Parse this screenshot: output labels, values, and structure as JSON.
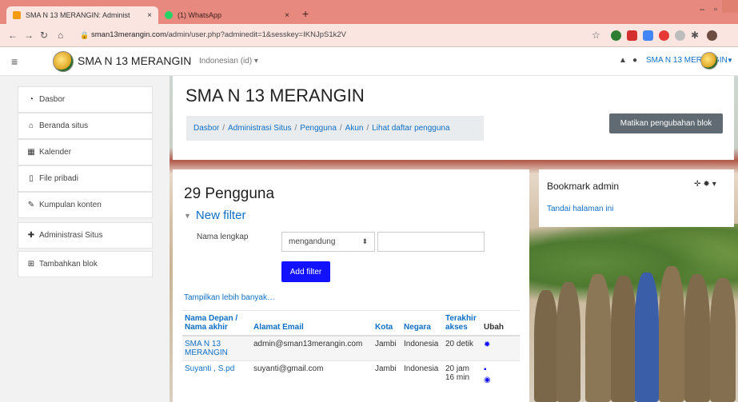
{
  "browser": {
    "tabs": [
      {
        "title": "SMA N 13 MERANGIN: Administ",
        "close": "×",
        "active": true
      },
      {
        "title": "(1) WhatsApp",
        "close": "×",
        "active": false
      }
    ],
    "new_tab": "+",
    "url_host": "sman13merangin.com",
    "url_path": "/admin/user.php?adminedit=1&sesskey=IKNJpS1k2V"
  },
  "navbar": {
    "site_name": "SMA N 13 MERANGIN",
    "language": "Indonesian (id) ▾",
    "user_name": "SMA N 13 MERANGIN"
  },
  "sidebar": {
    "items": [
      {
        "label": "Dasbor",
        "icon": "dashboard-icon"
      },
      {
        "label": "Beranda situs",
        "icon": "home-icon"
      },
      {
        "label": "Kalender",
        "icon": "calendar-icon"
      },
      {
        "label": "File pribadi",
        "icon": "file-icon"
      },
      {
        "label": "Kumpulan konten",
        "icon": "paintbrush-icon"
      },
      {
        "label": "Administrasi Situs",
        "icon": "wrench-icon"
      },
      {
        "label": "Tambahkan blok",
        "icon": "plus-square-icon"
      }
    ]
  },
  "header": {
    "title": "SMA N 13 MERANGIN",
    "breadcrumb": [
      "Dasbor",
      "Administrasi Situs",
      "Pengguna",
      "Akun",
      "Lihat daftar pengguna"
    ],
    "separator": "/",
    "edit_button": "Matikan pengubahan blok"
  },
  "main": {
    "users_title": "29 Pengguna",
    "filter_heading": "New filter",
    "filter_label": "Nama lengkap",
    "filter_operator": "mengandung",
    "filter_value": "",
    "add_filter": "Add filter",
    "show_more": "Tampilkan lebih banyak…",
    "columns": {
      "name_line1": "Nama Depan /",
      "name_line2": "Nama akhir",
      "email": "Alamat Email",
      "city": "Kota",
      "country": "Negara",
      "last_line1": "Terakhir",
      "last_line2": "akses",
      "edit": "Ubah"
    },
    "rows": [
      {
        "name_line1": "SMA N 13",
        "name_line2": "MERANGIN",
        "email": "admin@sman13merangin.com",
        "city": "Jambi",
        "country": "Indonesia",
        "last_line1": "20 detik",
        "last_line2": "",
        "actions": [
          "gear-icon"
        ]
      },
      {
        "name_line1": "Suyanti , S.pd",
        "name_line2": "",
        "email": "suyanti@gmail.com",
        "city": "Jambi",
        "country": "Indonesia",
        "last_line1": "20 jam",
        "last_line2": "16 min",
        "actions": [
          "trash-icon",
          "eye-icon"
        ]
      }
    ]
  },
  "bookmark": {
    "title": "Bookmark admin",
    "link": "Tandai halaman ini"
  },
  "colors": {
    "tab_bar": "#e8897f",
    "link_blue": "#0f6fc5",
    "button_blue": "#1212ff",
    "edit_button": "#5f6a73"
  }
}
